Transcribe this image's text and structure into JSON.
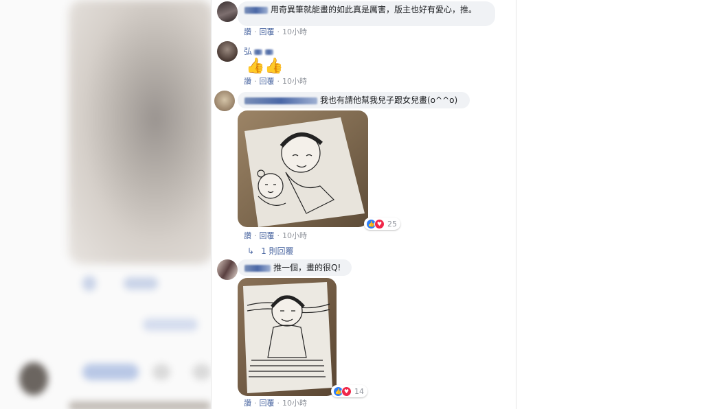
{
  "comments": [
    {
      "text": "用奇異筆就能畫的如此真是厲害，版主也好有愛心，推。",
      "actions": {
        "like": "讚",
        "reply": "回覆",
        "time": "10小時"
      }
    },
    {
      "name": "弘",
      "emoji": "👍👍",
      "actions": {
        "like": "讚",
        "reply": "回覆",
        "time": "10小時"
      }
    },
    {
      "text": "我也有請他幫我兒子跟女兒畫(o^^o)",
      "reactions": {
        "count": "25"
      },
      "actions": {
        "like": "讚",
        "reply": "回覆",
        "time": "10小時"
      },
      "reply_link": "1 則回覆"
    },
    {
      "text": "推一個，畫的很Q!",
      "reactions": {
        "count": "14"
      },
      "actions": {
        "like": "讚",
        "reply": "回覆",
        "time": "10小時"
      }
    }
  ],
  "colors": {
    "link": "#4b67a1",
    "bubble": "#f0f2f5",
    "meta": "#90949c"
  },
  "icons": [
    "like-reaction-icon",
    "love-reaction-icon",
    "reply-arrow-icon",
    "thumbs-up-emoji-icon"
  ]
}
